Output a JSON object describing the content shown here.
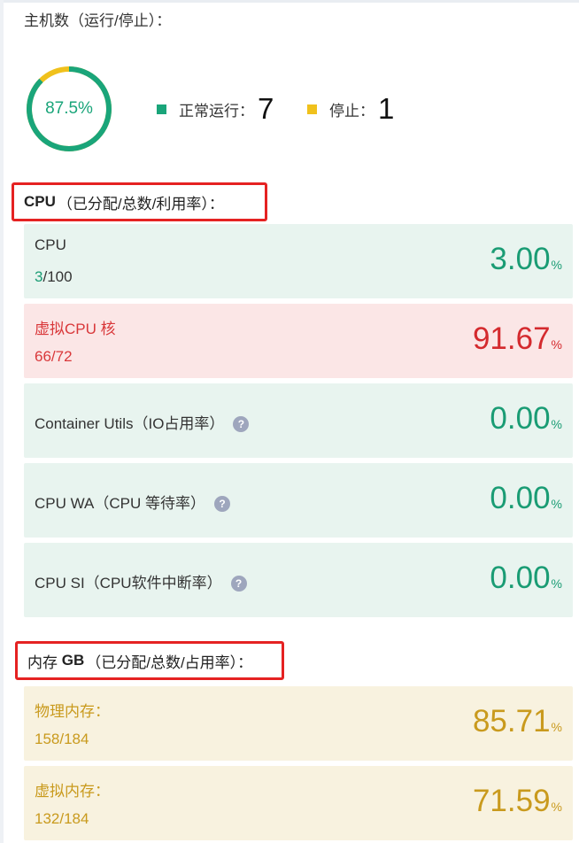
{
  "hosts": {
    "title": "主机数（运行/停止）：",
    "donut_percent": "87.5%",
    "donut_fraction": 0.875,
    "running_color": "#1aa57a",
    "stopped_color": "#f0c11c",
    "running_label": "正常运行：",
    "running_count": "7",
    "stopped_label": "停止：",
    "stopped_count": "1"
  },
  "cpu_section": {
    "title_bold": "CPU",
    "title_rest": "（已分配/总数/利用率）：",
    "cards": [
      {
        "name": "CPU",
        "sub_hl": "3",
        "sub_rest": "/100",
        "value": "3.00",
        "unit": "%"
      },
      {
        "name": "虚拟CPU 核",
        "sub": "66/72",
        "value": "91.67",
        "unit": "%"
      },
      {
        "name": "Container Utils（IO占用率）",
        "value": "0.00",
        "unit": "%",
        "help": "?"
      },
      {
        "name": "CPU WA（CPU 等待率）",
        "value": "0.00",
        "unit": "%",
        "help": "?"
      },
      {
        "name": "CPU SI（CPU软件中断率）",
        "value": "0.00",
        "unit": "%",
        "help": "?"
      }
    ]
  },
  "mem_section": {
    "title_pre": "内存 ",
    "title_bold": "GB",
    "title_rest": "（已分配/总数/占用率）：",
    "cards": [
      {
        "name": "物理内存：",
        "sub": "158/184",
        "value": "85.71",
        "unit": "%"
      },
      {
        "name": "虚拟内存：",
        "sub": "132/184",
        "value": "71.59",
        "unit": "%"
      }
    ]
  }
}
